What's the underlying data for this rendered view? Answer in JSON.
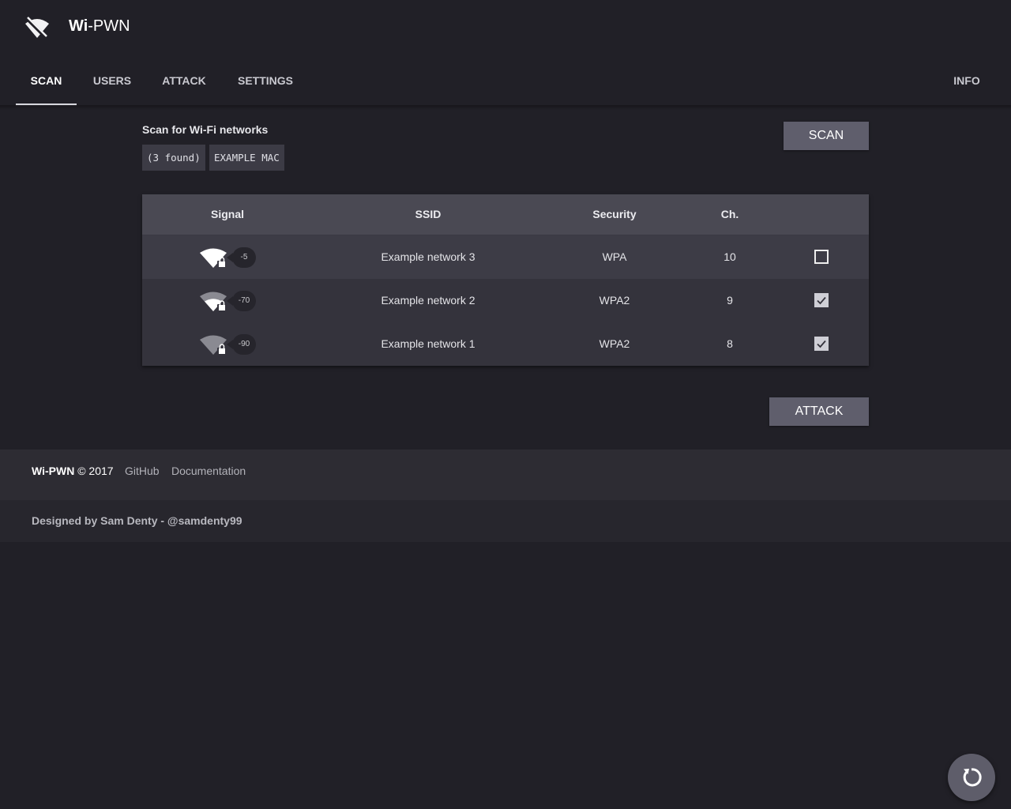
{
  "app": {
    "name_bold": "Wi",
    "name_rest": "-PWN",
    "logo_icon": "wifi-off-icon"
  },
  "nav": {
    "tabs": [
      {
        "label": "SCAN",
        "active": true
      },
      {
        "label": "USERS",
        "active": false
      },
      {
        "label": "ATTACK",
        "active": false
      },
      {
        "label": "SETTINGS",
        "active": false
      }
    ],
    "info_label": "INFO"
  },
  "scan": {
    "title": "Scan for Wi-Fi networks",
    "found_text": "(3 found)",
    "mac_text": "EXAMPLE MAC",
    "scan_button": "SCAN"
  },
  "table": {
    "headers": [
      "Signal",
      "SSID",
      "Security",
      "Ch.",
      ""
    ],
    "rows": [
      {
        "rssi": "-5",
        "signal_level": 1.0,
        "ssid": "Example network 3",
        "security": "WPA",
        "channel": "10",
        "selected": false
      },
      {
        "rssi": "-70",
        "signal_level": 0.6,
        "ssid": "Example network 2",
        "security": "WPA2",
        "channel": "9",
        "selected": true
      },
      {
        "rssi": "-90",
        "signal_level": 0.2,
        "ssid": "Example network 1",
        "security": "WPA2",
        "channel": "8",
        "selected": true
      }
    ]
  },
  "attack_button": "ATTACK",
  "footer": {
    "brand": "Wi-PWN",
    "copyright": "© 2017",
    "links": [
      "GitHub",
      "Documentation"
    ],
    "credit": "Designed by Sam Denty - @samdenty99"
  },
  "fab": {
    "icon": "refresh-icon"
  },
  "colors": {
    "background": "#212027",
    "button": "#5f5e6c",
    "table_header": "#4a4953",
    "footer": "#2d2c33"
  }
}
